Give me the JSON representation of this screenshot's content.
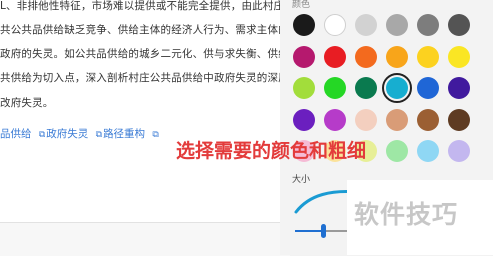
{
  "document": {
    "lines": [
      "L、非排他性特征，市场难以提供或不能完全提供，由此村庄公共品供",
      "共公共品供给缺乏竞争、供给主体的经济人行为、需求主体的参与性不足",
      "政府的失灵。如公共品供给的城乡二元化、供与求失衡、供给效率低",
      "共供给为切入点，深入剖析村庄公共品供给中政府失灵的深层原因，以",
      "改府失灵。"
    ],
    "keywords": [
      "品供给",
      "政府失灵",
      "路径重构",
      ""
    ],
    "keyword_icon": "keyword-link-icon"
  },
  "panel": {
    "title": "颜色",
    "size_label": "大小"
  },
  "swatches": [
    {
      "color": "#1a1a1a",
      "row": 0,
      "col": 0,
      "selected": false
    },
    {
      "color": "#ffffff",
      "row": 0,
      "col": 1,
      "selected": false
    },
    {
      "color": "#d2d2d2",
      "row": 0,
      "col": 2,
      "selected": false
    },
    {
      "color": "#a8a8a8",
      "row": 0,
      "col": 3,
      "selected": false
    },
    {
      "color": "#7d7d7d",
      "row": 0,
      "col": 4,
      "selected": false
    },
    {
      "color": "#545454",
      "row": 0,
      "col": 5,
      "selected": false
    },
    {
      "color": "#b5196e",
      "row": 1,
      "col": 0,
      "selected": false
    },
    {
      "color": "#e81d23",
      "row": 1,
      "col": 1,
      "selected": false
    },
    {
      "color": "#f36a1e",
      "row": 1,
      "col": 2,
      "selected": false
    },
    {
      "color": "#f8a51a",
      "row": 1,
      "col": 3,
      "selected": false
    },
    {
      "color": "#fcd21f",
      "row": 1,
      "col": 4,
      "selected": false
    },
    {
      "color": "#fae624",
      "row": 1,
      "col": 5,
      "selected": false
    },
    {
      "color": "#a2dd3b",
      "row": 2,
      "col": 0,
      "selected": false
    },
    {
      "color": "#25d725",
      "row": 2,
      "col": 1,
      "selected": false
    },
    {
      "color": "#0a7a4f",
      "row": 2,
      "col": 2,
      "selected": false
    },
    {
      "color": "#17aed0",
      "row": 2,
      "col": 3,
      "selected": true
    },
    {
      "color": "#1f66d6",
      "row": 2,
      "col": 4,
      "selected": false
    },
    {
      "color": "#401a9e",
      "row": 2,
      "col": 5,
      "selected": false
    },
    {
      "color": "#6b1fbf",
      "row": 3,
      "col": 0,
      "selected": false
    },
    {
      "color": "#b63bc9",
      "row": 3,
      "col": 1,
      "selected": false
    },
    {
      "color": "#f3cfbf",
      "row": 3,
      "col": 2,
      "selected": false
    },
    {
      "color": "#d99c77",
      "row": 3,
      "col": 3,
      "selected": false
    },
    {
      "color": "#9b5f33",
      "row": 3,
      "col": 4,
      "selected": false
    },
    {
      "color": "#5e3b22",
      "row": 3,
      "col": 5,
      "selected": false
    },
    {
      "color": "#f5bbd5",
      "row": 4,
      "col": 0,
      "selected": false
    },
    {
      "color": "#fbe29a",
      "row": 4,
      "col": 1,
      "selected": false
    },
    {
      "color": "#e7ef97",
      "row": 4,
      "col": 2,
      "selected": false
    },
    {
      "color": "#9ee7a5",
      "row": 4,
      "col": 3,
      "selected": false
    },
    {
      "color": "#8fd7f4",
      "row": 4,
      "col": 4,
      "selected": false
    },
    {
      "color": "#c3b7ef",
      "row": 4,
      "col": 5,
      "selected": false
    }
  ],
  "slider": {
    "value_percent": 19
  },
  "overlay": {
    "caption": "选择需要的颜色和粗细",
    "watermark": "软件技巧"
  }
}
